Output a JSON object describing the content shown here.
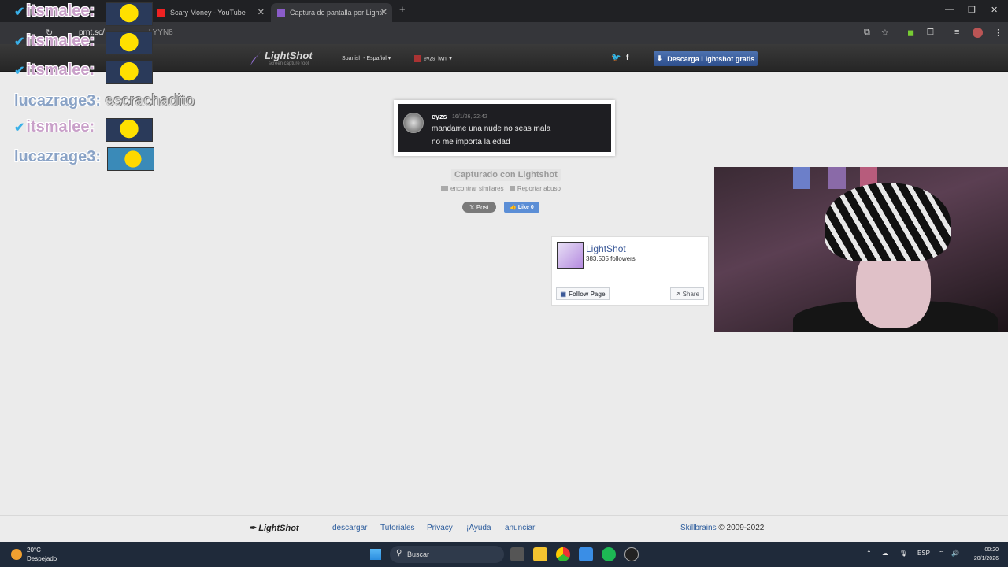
{
  "browser": {
    "tabs": [
      {
        "label": "Scary Money - YouTube"
      },
      {
        "label": "Captura de pantalla por Lightsh"
      }
    ],
    "url": "prnt.sc/",
    "url_suffix": "LYYN8",
    "new_tab": "+"
  },
  "lightshot": {
    "logo": "LightShot",
    "tagline": "screen capture tool",
    "language": "Spanish - Español",
    "username": "eyzs_iwnl",
    "download_button": "Descarga Lightshot gratis",
    "message": {
      "sender": "eyzs",
      "time": "16/1/26, 22:42",
      "line1": "mandame una nude no seas mala",
      "line2": "no me importa la edad"
    },
    "captured_label": "Capturado con Lightshot",
    "find_similar": "encontrar similares",
    "report": "Reportar abuso",
    "x_post": "Post",
    "fb_like": "Like 0",
    "fb_page": {
      "name": "LightShot",
      "followers": "383,505 followers",
      "follow": "Follow Page",
      "share": "Share"
    }
  },
  "footer": {
    "logo": "LightShot",
    "links": [
      "descargar",
      "Tutoriales",
      "Privacy",
      "¡Ayuda",
      "anunciar"
    ],
    "company": "Skillbrains",
    "copyright": "© 2009-2022"
  },
  "chat": [
    {
      "user": "itsmalee:",
      "message": ""
    },
    {
      "user": "itsmalee:",
      "message": ""
    },
    {
      "user": "itsmalee:",
      "message": ""
    },
    {
      "user": "lucazrage3:",
      "message": "escrachadito"
    },
    {
      "user": "itsmalee:",
      "message": ""
    },
    {
      "user": "lucazrage3:",
      "message": ""
    }
  ],
  "taskbar": {
    "temperature": "20°C",
    "condition": "Despejado",
    "search": "Buscar",
    "language": "ESP",
    "time": "00:20",
    "date": "20/1/2026"
  }
}
